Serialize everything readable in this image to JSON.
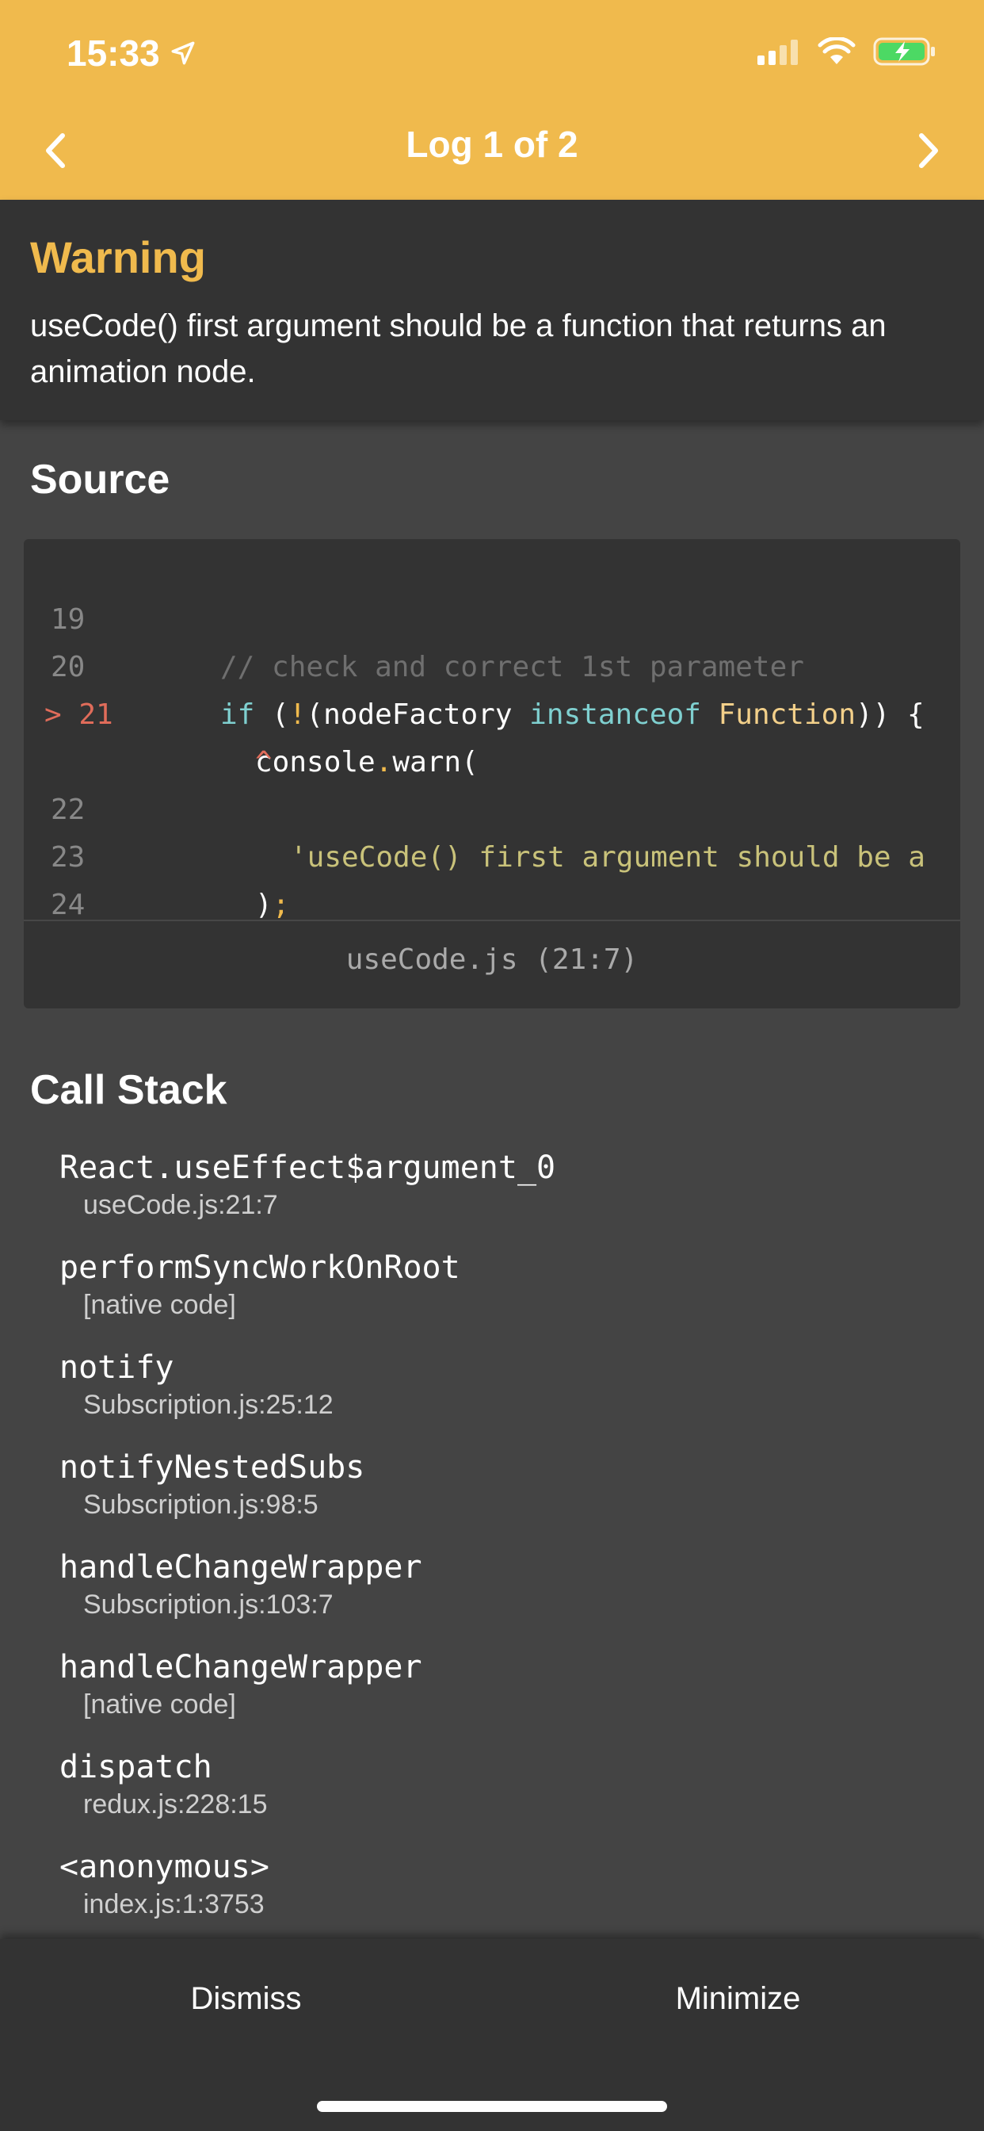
{
  "status_bar": {
    "time": "15:33",
    "icons": [
      "location-arrow-icon",
      "cellular-signal-icon",
      "wifi-icon",
      "battery-charging-icon"
    ]
  },
  "nav": {
    "title": "Log 1 of 2",
    "prev_icon": "chevron-left-icon",
    "next_icon": "chevron-right-icon"
  },
  "warning": {
    "level": "Warning",
    "message": "useCode() first argument should be a function that returns an animation node."
  },
  "source": {
    "title": "Source",
    "line_numbers": [
      "19",
      "20",
      "> 21",
      "",
      "22",
      "23",
      "24"
    ],
    "file_location": "useCode.js (21:7)"
  },
  "call_stack": {
    "title": "Call Stack",
    "frames": [
      {
        "name": "React.useEffect$argument_0",
        "location": "useCode.js:21:7"
      },
      {
        "name": "performSyncWorkOnRoot",
        "location": "[native code]"
      },
      {
        "name": "notify",
        "location": "Subscription.js:25:12"
      },
      {
        "name": "notifyNestedSubs",
        "location": "Subscription.js:98:5"
      },
      {
        "name": "handleChangeWrapper",
        "location": "Subscription.js:103:7"
      },
      {
        "name": "handleChangeWrapper",
        "location": "[native code]"
      },
      {
        "name": "dispatch",
        "location": "redux.js:228:15"
      },
      {
        "name": "<anonymous>",
        "location": "index.js:1:3753"
      }
    ]
  },
  "footer": {
    "dismiss_label": "Dismiss",
    "minimize_label": "Minimize"
  },
  "colors": {
    "header_bg": "#F0BA4D",
    "warning_text": "#F0BA4D",
    "panel_bg": "#333333",
    "body_bg": "#444444"
  }
}
